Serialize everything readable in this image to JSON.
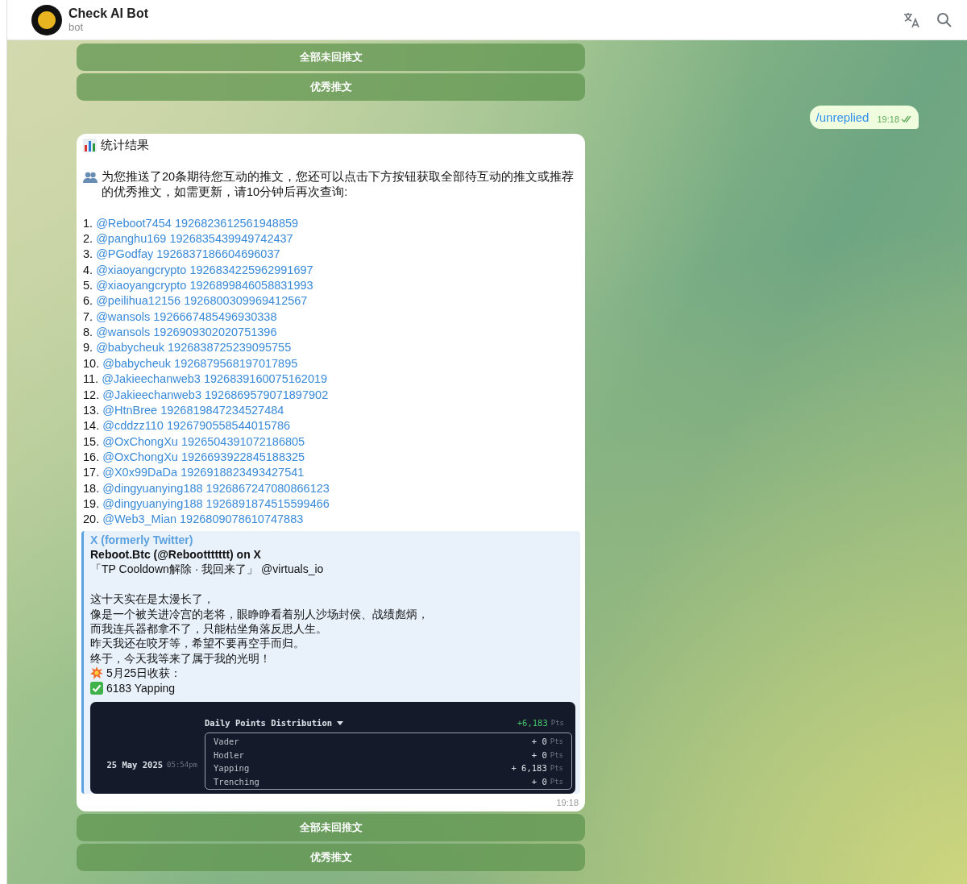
{
  "header": {
    "title": "Check AI Bot",
    "subtitle": "bot"
  },
  "keyboard_top": [
    {
      "label": "全部未回推文"
    },
    {
      "label": "优秀推文"
    }
  ],
  "outgoing": {
    "text": "/unreplied",
    "time": "19:18"
  },
  "message": {
    "title": "统计结果",
    "intro": "为您推送了20条期待您互动的推文，您还可以点击下方按钮获取全部待互动的推文或推荐的优秀推文，如需更新，请10分钟后再次查询:",
    "items": [
      {
        "number": "1.",
        "link": "@Reboot7454 1926823612561948859"
      },
      {
        "number": "2.",
        "link": "@panghu169 1926835439949742437"
      },
      {
        "number": "3.",
        "link": "@PGodfay 1926837186604696037"
      },
      {
        "number": "4.",
        "link": "@xiaoyangcrypto 1926834225962991697"
      },
      {
        "number": "5.",
        "link": "@xiaoyangcrypto 1926899846058831993"
      },
      {
        "number": "6.",
        "link": "@peilihua12156 1926800309969412567"
      },
      {
        "number": "7.",
        "link": "@wansols 1926667485496930338"
      },
      {
        "number": "8.",
        "link": "@wansols 1926909302020751396"
      },
      {
        "number": "9.",
        "link": "@babycheuk 1926838725239095755"
      },
      {
        "number": "10.",
        "link": "@babycheuk 1926879568197017895"
      },
      {
        "number": "11.",
        "link": "@Jakieechanweb3 1926839160075162019"
      },
      {
        "number": "12.",
        "link": "@Jakieechanweb3 1926869579071897902"
      },
      {
        "number": "13.",
        "link": "@HtnBree 1926819847234527484"
      },
      {
        "number": "14.",
        "link": "@cddzz110 1926790558544015786"
      },
      {
        "number": "15.",
        "link": "@OxChongXu 1926504391072186805"
      },
      {
        "number": "16.",
        "link": "@OxChongXu 1926693922845188325"
      },
      {
        "number": "17.",
        "link": "@X0x99DaDa 1926918823493427541"
      },
      {
        "number": "18.",
        "link": "@dingyuanying188 1926867247080866123"
      },
      {
        "number": "19.",
        "link": "@dingyuanying188 1926891874515599466"
      },
      {
        "number": "20.",
        "link": "@Web3_Mian 1926809078610747883"
      }
    ],
    "preview": {
      "site": "X (formerly Twitter)",
      "title": "Reboot.Btc (@Reboottttttt) on X",
      "paragraphs": [
        [
          {
            "kind": "plain",
            "text": "「TP Cooldown解除 · 我回来了」 @virtuals_io"
          }
        ],
        [
          {
            "kind": "plain",
            "text": "这十天实在是太漫长了，"
          },
          {
            "kind": "plain",
            "text": "像是一个被关进冷宫的老将，眼睁睁看着别人沙场封侯、战绩彪炳，"
          },
          {
            "kind": "plain",
            "text": "而我连兵器都拿不了，只能枯坐角落反思人生。"
          },
          {
            "kind": "plain",
            "text": "昨天我还在咬牙等，希望不要再空手而归。"
          },
          {
            "kind": "plain",
            "text": "终于，今天我等来了属于我的光明！"
          },
          {
            "kind": "burst",
            "text": "5月25日收获："
          },
          {
            "kind": "check",
            "text": "6183 Yapping"
          }
        ]
      ],
      "image": {
        "heading": "Daily Points Distribution",
        "total": "+6,183",
        "total_unit": "Pts",
        "date": "25 May 2025",
        "clock": "05:54pm",
        "rows": [
          {
            "label": "Vader",
            "value": "+ 0",
            "unit": "Pts"
          },
          {
            "label": "Hodler",
            "value": "+ 0",
            "unit": "Pts"
          },
          {
            "label": "Yapping",
            "value": "+ 6,183",
            "unit": "Pts"
          },
          {
            "label": "Trenching",
            "value": "+ 0",
            "unit": "Pts"
          }
        ]
      }
    },
    "time": "19:18"
  },
  "keyboard_bottom": [
    {
      "label": "全部未回推文"
    },
    {
      "label": "优秀推文"
    }
  ]
}
